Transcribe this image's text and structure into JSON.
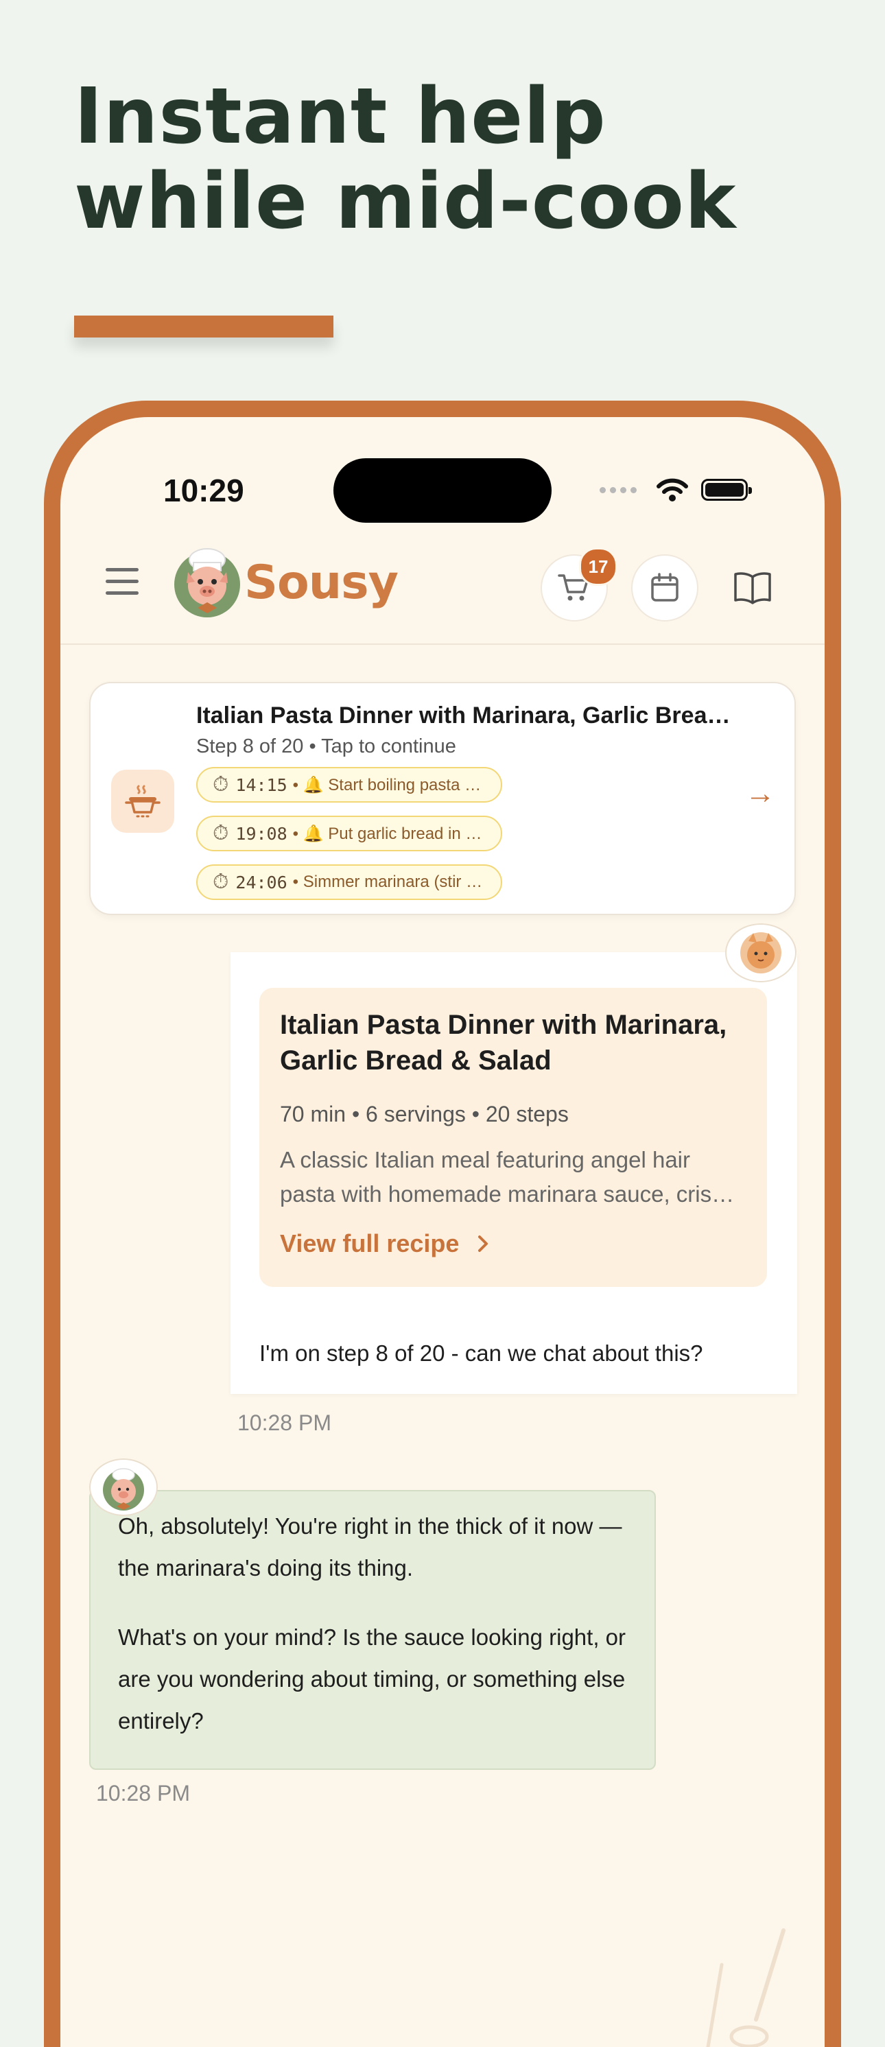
{
  "headline": "Instant help while mid-cook",
  "status_bar": {
    "time": "10:29"
  },
  "app": {
    "logo_text": "Sousy",
    "cart_badge": "17"
  },
  "active_recipe": {
    "title": "Italian Pasta Dinner with Marinara, Garlic Bread & Salad",
    "subtitle": "Step 8 of 20 • Tap to continue",
    "timers": [
      {
        "time": "14:15",
        "label": "• 🔔 Start boiling pasta water"
      },
      {
        "time": "19:08",
        "label": "• 🔔 Put garlic bread in oven"
      },
      {
        "time": "24:06",
        "label": "• Simmer marinara (stir occasionally)"
      }
    ],
    "arrow": "→"
  },
  "user_message": {
    "recipe_title": "Italian Pasta Dinner with Marinara, Garlic Bread & Salad",
    "recipe_meta": "70 min • 6 servings • 20 steps",
    "recipe_description": "A classic Italian meal featuring angel hair pasta with homemade marinara sauce, crispy garlic bread and a fresh salad.",
    "view_recipe": "View full recipe",
    "text": "I'm on step 8 of 20 - can we chat about this?",
    "timestamp": "10:28 PM"
  },
  "assistant_message": {
    "paragraph_1": "Oh, absolutely! You're right in the thick of it now — the marinara's doing its thing.",
    "paragraph_2": "What's on your mind? Is the sauce looking right, or are you wondering about timing, or something else entirely?",
    "timestamp": "10:28 PM"
  },
  "colors": {
    "background": "#eff4ee",
    "headline": "#26372c",
    "brand": "#c8733c",
    "screen": "#fdf6ea",
    "assistant_bubble": "#e6eedb",
    "timer_pill": "#fffbe2"
  }
}
